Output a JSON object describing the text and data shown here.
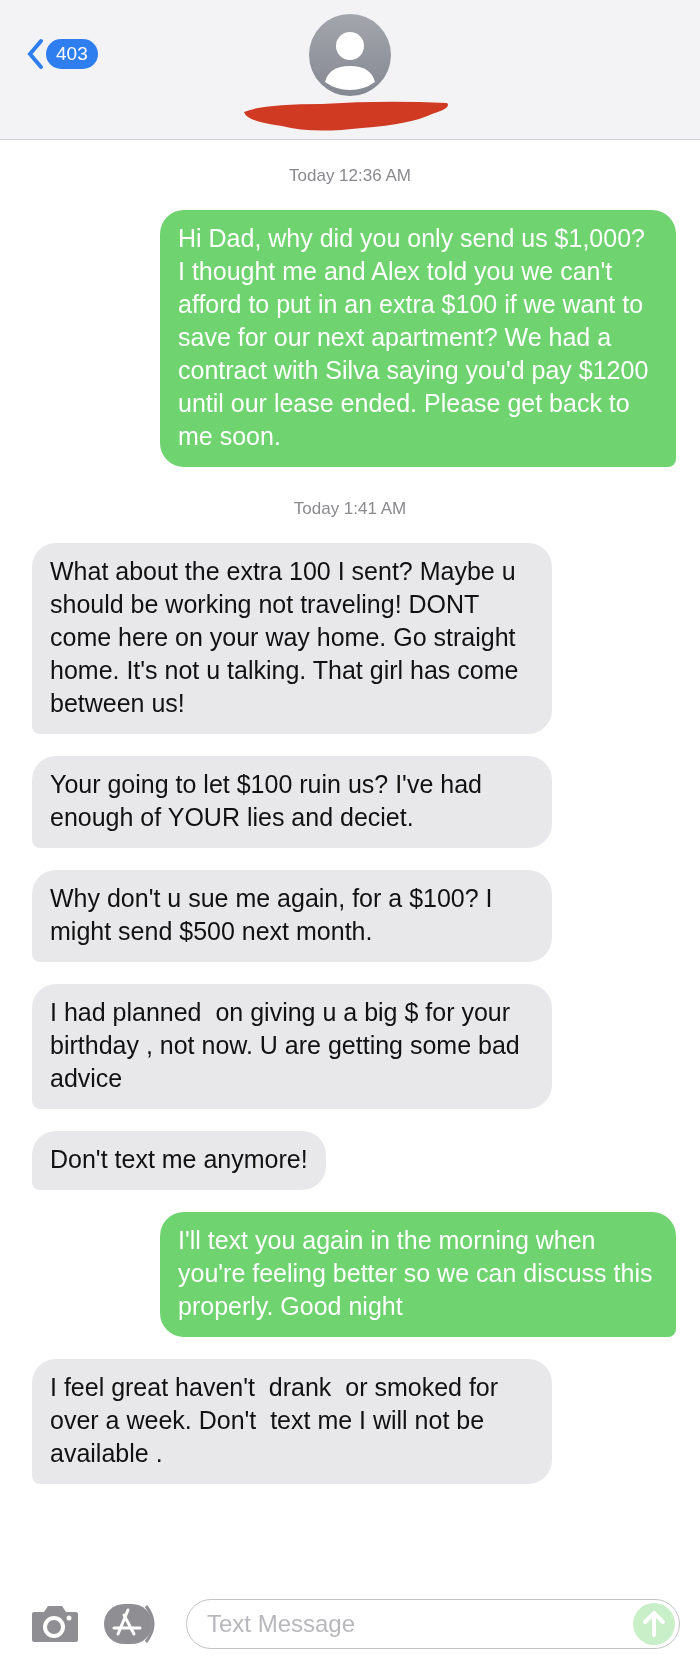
{
  "header": {
    "back_count": "403"
  },
  "messages": [
    {
      "kind": "timestamp",
      "text": "Today 12:36 AM"
    },
    {
      "kind": "sent",
      "text": "Hi Dad, why did you only send us $1,000? I thought me and Alex told you we can't afford to put in an extra $100 if we want to save for our next apartment? We had a contract with Silva saying you'd pay $1200 until our lease ended. Please get back to me soon."
    },
    {
      "kind": "timestamp",
      "text": "Today 1:41 AM"
    },
    {
      "kind": "received",
      "text": "What about the extra 100 I sent? Maybe u should be working not traveling! DONT come here on your way home. Go straight home. It's not u talking. That girl has come between us!"
    },
    {
      "kind": "received",
      "text": "Your going to let $100 ruin us? I've had enough of YOUR lies and deciet."
    },
    {
      "kind": "received",
      "text": "Why don't u sue me again, for a $100? I might send $500 next month."
    },
    {
      "kind": "received",
      "text": "I had planned  on giving u a big $ for your birthday , not now. U are getting some bad  advice"
    },
    {
      "kind": "received",
      "text": "Don't text me anymore!"
    },
    {
      "kind": "sent",
      "text": "I'll text you again in the morning when you're feeling better so we can discuss this properly. Good night"
    },
    {
      "kind": "received",
      "text": "I feel great haven't  drank  or smoked for over a week. Don't  text me I will not be available ."
    }
  ],
  "composer": {
    "placeholder": "Text Message"
  }
}
